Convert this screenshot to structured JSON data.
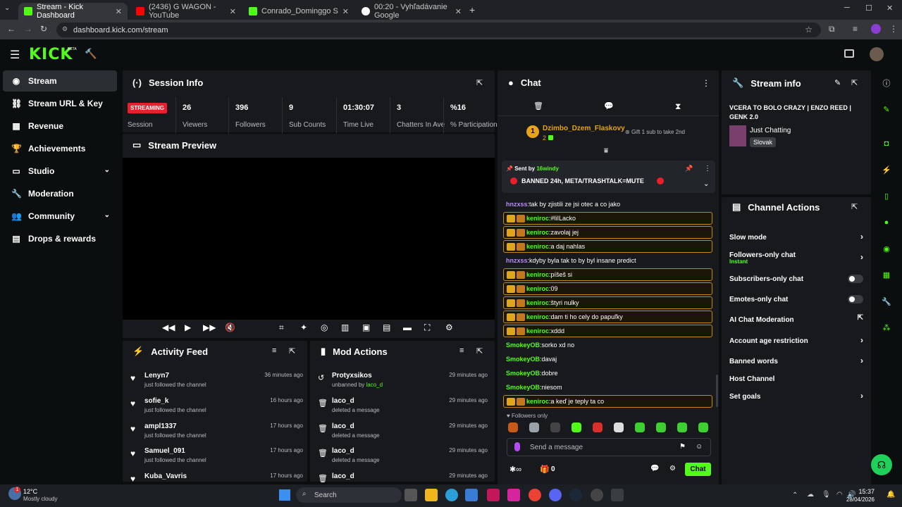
{
  "browser": {
    "tabs": [
      {
        "label": "Stream - Kick Dashboard",
        "active": true,
        "icon": "kick-favicon"
      },
      {
        "label": "(2436) G WAGON - YouTube",
        "active": false,
        "icon": "youtube-favicon"
      },
      {
        "label": "Conrado_Dominggo Stream - W",
        "active": false,
        "icon": "kick-favicon"
      },
      {
        "label": "00:20 - Vyhľadávanie Google",
        "active": false,
        "icon": "google-favicon"
      }
    ],
    "url": "dashboard.kick.com/stream"
  },
  "brand": {
    "logo": "KICK",
    "beta": "BETA",
    "accent": "#53fc18"
  },
  "sidebar": {
    "items": [
      {
        "label": "Stream",
        "icon": "broadcast-icon",
        "active": true
      },
      {
        "label": "Stream URL & Key",
        "icon": "link-icon"
      },
      {
        "label": "Revenue",
        "icon": "revenue-icon"
      },
      {
        "label": "Achievements",
        "icon": "trophy-icon"
      },
      {
        "label": "Studio",
        "icon": "studio-icon",
        "expandable": true
      },
      {
        "label": "Moderation",
        "icon": "wrench-icon"
      },
      {
        "label": "Community",
        "icon": "community-icon",
        "expandable": true
      },
      {
        "label": "Drops & rewards",
        "icon": "drops-icon"
      }
    ]
  },
  "session": {
    "title": "Session Info",
    "status": "STREAMING",
    "status_label": "Session",
    "stats": [
      {
        "value": "26",
        "label": "Viewers"
      },
      {
        "value": "396",
        "label": "Followers"
      },
      {
        "value": "9",
        "label": "Sub Counts"
      },
      {
        "value": "01:30:07",
        "label": "Time Live"
      },
      {
        "value": "3",
        "label": "Chatters In Ave"
      },
      {
        "value": "%16",
        "label": "% Participation"
      }
    ]
  },
  "preview": {
    "title": "Stream Preview"
  },
  "activity": {
    "title": "Activity Feed",
    "items": [
      {
        "name": "Lenyn7",
        "sub": "just followed the channel",
        "time": "36 minutes ago"
      },
      {
        "name": "sofie_k",
        "sub": "just followed the channel",
        "time": "16 hours ago"
      },
      {
        "name": "ampl1337",
        "sub": "just followed the channel",
        "time": "17 hours ago"
      },
      {
        "name": "Samuel_091",
        "sub": "just followed the channel",
        "time": "17 hours ago"
      },
      {
        "name": "Kuba_Vavris",
        "sub": "",
        "time": "17 hours ago"
      }
    ]
  },
  "mod": {
    "title": "Mod Actions",
    "items": [
      {
        "name": "Protyxsikos",
        "sub": "unbanned by",
        "by": "laco_d",
        "time": "29 minutes ago",
        "icon": "undo-icon"
      },
      {
        "name": "laco_d",
        "sub": "deleted a message",
        "by": "",
        "time": "29 minutes ago",
        "icon": "trash-icon"
      },
      {
        "name": "laco_d",
        "sub": "deleted a message",
        "by": "",
        "time": "29 minutes ago",
        "icon": "trash-icon"
      },
      {
        "name": "laco_d",
        "sub": "deleted a message",
        "by": "",
        "time": "29 minutes ago",
        "icon": "trash-icon"
      },
      {
        "name": "laco_d",
        "sub": "",
        "by": "",
        "time": "29 minutes ago",
        "icon": "trash-icon"
      }
    ]
  },
  "chat": {
    "title": "Chat",
    "gifter": {
      "rank": "1",
      "name": "Dzimbo_Dzem_Flaskovy",
      "count": "2",
      "gift_text": "Gift 1 sub to take 2nd"
    },
    "pinned": {
      "sent_by": "Sent by",
      "author": "16windy",
      "text": "BANNED 24h, META/TRASHTALK=MUTE"
    },
    "messages": [
      {
        "user": "hnzxss",
        "text": "tak by zjistili ze jsi otec a co jako",
        "hl": false,
        "color": "#b78cf5",
        "badges": false
      },
      {
        "user": "keniroc",
        "text": "#liILacko",
        "hl": true,
        "color": "#53fc18",
        "badges": true
      },
      {
        "user": "keniroc",
        "text": "zavolaj jej",
        "hl": true,
        "color": "#53fc18",
        "badges": true
      },
      {
        "user": "keniroc",
        "text": "a daj nahlas",
        "hl": true,
        "color": "#53fc18",
        "badges": true
      },
      {
        "user": "hnzxss",
        "text": "kdyby byla tak to by byl insane predict",
        "hl": false,
        "color": "#b78cf5",
        "badges": false
      },
      {
        "user": "keniroc",
        "text": "píšeš si",
        "hl": true,
        "color": "#53fc18",
        "badges": true
      },
      {
        "user": "keniroc",
        "text": "09",
        "hl": true,
        "color": "#53fc18",
        "badges": true
      },
      {
        "user": "keniroc",
        "text": "štyri nulky",
        "hl": true,
        "color": "#53fc18",
        "badges": true
      },
      {
        "user": "keniroc",
        "text": "dam ti ho cely do papuľky",
        "hl": true,
        "color": "#53fc18",
        "badges": true
      },
      {
        "user": "keniroc",
        "text": "xddd",
        "hl": true,
        "color": "#53fc18",
        "badges": true
      },
      {
        "user": "SmokeyOB",
        "text": "sorko xd no",
        "hl": false,
        "color": "#53fc18",
        "badges": false
      },
      {
        "user": "SmokeyOB",
        "text": "davaj",
        "hl": false,
        "color": "#53fc18",
        "badges": false
      },
      {
        "user": "SmokeyOB",
        "text": "dobre",
        "hl": false,
        "color": "#53fc18",
        "badges": false
      },
      {
        "user": "SmokeyOB",
        "text": "niesom",
        "hl": false,
        "color": "#53fc18",
        "badges": false
      },
      {
        "user": "keniroc",
        "text": "a keď je teply ta co",
        "hl": true,
        "color": "#53fc18",
        "badges": true
      }
    ],
    "followers_only": "Followers only",
    "input_placeholder": "Send a message",
    "points": "0",
    "send_label": "Chat"
  },
  "stream_info": {
    "title_label": "Stream info",
    "stream_title": "VCERA TO BOLO CRAZY | ENZO REED | GENK 2.0",
    "category": "Just Chatting",
    "language": "Slovak"
  },
  "channel_actions": {
    "title": "Channel Actions",
    "items": [
      {
        "label": "Slow mode",
        "control": "chevron"
      },
      {
        "label": "Followers-only chat",
        "sub": "Instant",
        "control": "chevron"
      },
      {
        "label": "Subscribers-only chat",
        "control": "toggle"
      },
      {
        "label": "Emotes-only chat",
        "control": "toggle"
      },
      {
        "label": "AI Chat Moderation",
        "control": "external"
      },
      {
        "label": "Account age restriction",
        "control": "chevron"
      },
      {
        "label": "Banned words",
        "control": "chevron"
      },
      {
        "label": "Host Channel",
        "control": "none"
      },
      {
        "label": "Set goals",
        "control": "chevron"
      }
    ]
  },
  "taskbar": {
    "weather_temp": "12°C",
    "weather_desc": "Mostly cloudy",
    "search": "Search",
    "time": "15:37",
    "date": "28/04/2026",
    "notif": "1"
  }
}
